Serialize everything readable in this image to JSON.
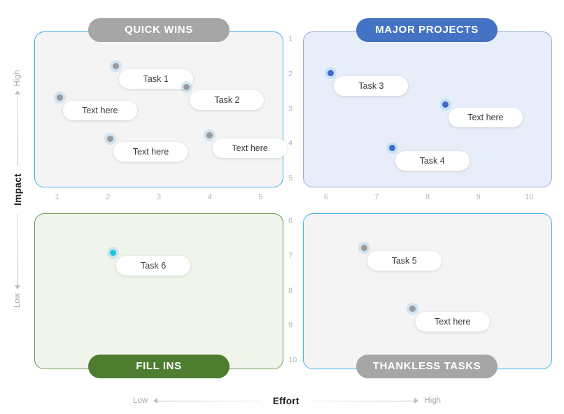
{
  "chart_data": {
    "type": "scatter",
    "title": "Impact Effort Matrix",
    "xlabel": "Effort",
    "ylabel": "Impact",
    "xlim": [
      0,
      10
    ],
    "ylim": [
      1,
      10
    ],
    "grid": false,
    "legend": "none",
    "x_axis": {
      "label": "Effort",
      "low_label": "Low",
      "high_label": "High",
      "left_ticks": [
        "1",
        "2",
        "3",
        "4",
        "5"
      ],
      "right_ticks": [
        "6",
        "7",
        "8",
        "9",
        "10"
      ]
    },
    "y_axis": {
      "label": "Impact",
      "high_label": "High",
      "low_label": "Low",
      "top_ticks": [
        "1",
        "2",
        "3",
        "4",
        "5"
      ],
      "bottom_ticks": [
        "6",
        "7",
        "8",
        "9",
        "10"
      ]
    },
    "quadrants": [
      {
        "id": "quick-wins",
        "title": "QUICK WINS",
        "pill_color": "#a6a6a6",
        "fill_color": "#f4f4f4",
        "border_color": "#3cb3ea",
        "x_range": [
          1,
          5
        ],
        "y_range": [
          1,
          5
        ]
      },
      {
        "id": "major-projects",
        "title": "MAJOR PROJECTS",
        "pill_color": "#4472c4",
        "fill_color": "#e8eef9",
        "border_color": "#93a9d6",
        "x_range": [
          6,
          10
        ],
        "y_range": [
          1,
          5
        ]
      },
      {
        "id": "fill-ins",
        "title": "FILL INS",
        "pill_color": "#4f7d30",
        "fill_color": "#eff5ea",
        "border_color": "#6a9a52",
        "x_range": [
          1,
          5
        ],
        "y_range": [
          6,
          10
        ]
      },
      {
        "id": "thankless-tasks",
        "title": "THANKLESS TASKS",
        "pill_color": "#a6a6a6",
        "fill_color": "#f4f4f4",
        "border_color": "#3cb3ea",
        "x_range": [
          6,
          10
        ],
        "y_range": [
          6,
          10
        ]
      }
    ],
    "points": [
      {
        "label": "Task 1",
        "x": 2.15,
        "y": 1.75,
        "quadrant": "quick-wins",
        "color": "#9b9b9b"
      },
      {
        "label": "Text here",
        "x": 1.05,
        "y": 2.65,
        "quadrant": "quick-wins",
        "color": "#9b9b9b"
      },
      {
        "label": "Task 2",
        "x": 3.55,
        "y": 2.35,
        "quadrant": "quick-wins",
        "color": "#9b9b9b"
      },
      {
        "label": "Text here",
        "x": 2.05,
        "y": 3.85,
        "quadrant": "quick-wins",
        "color": "#9b9b9b"
      },
      {
        "label": "Text here",
        "x": 4.0,
        "y": 3.75,
        "quadrant": "quick-wins",
        "color": "#9b9b9b"
      },
      {
        "label": "Task 3",
        "x": 6.1,
        "y": 1.95,
        "quadrant": "major-projects",
        "color": "#4169c8"
      },
      {
        "label": "Text here",
        "x": 8.35,
        "y": 2.85,
        "quadrant": "major-projects",
        "color": "#4169c8"
      },
      {
        "label": "Task 4",
        "x": 7.3,
        "y": 4.1,
        "quadrant": "major-projects",
        "color": "#4169c8"
      },
      {
        "label": "Task 6",
        "x": 2.1,
        "y": 6.9,
        "quadrant": "fill-ins",
        "color": "#1ec5de"
      },
      {
        "label": "Task 5",
        "x": 6.75,
        "y": 6.75,
        "quadrant": "thankless-tasks",
        "color": "#9b9b9b"
      },
      {
        "label": "Text here",
        "x": 7.7,
        "y": 8.5,
        "quadrant": "thankless-tasks",
        "color": "#9b9b9b"
      }
    ]
  },
  "quadrant_titles": {
    "quick_wins": "QUICK WINS",
    "major_projects": "MAJOR PROJECTS",
    "fill_ins": "FILL INS",
    "thankless_tasks": "THANKLESS TASKS"
  },
  "axes": {
    "impact": {
      "name": "Impact",
      "high": "High",
      "low": "Low"
    },
    "effort": {
      "name": "Effort",
      "low": "Low",
      "high": "High"
    }
  }
}
